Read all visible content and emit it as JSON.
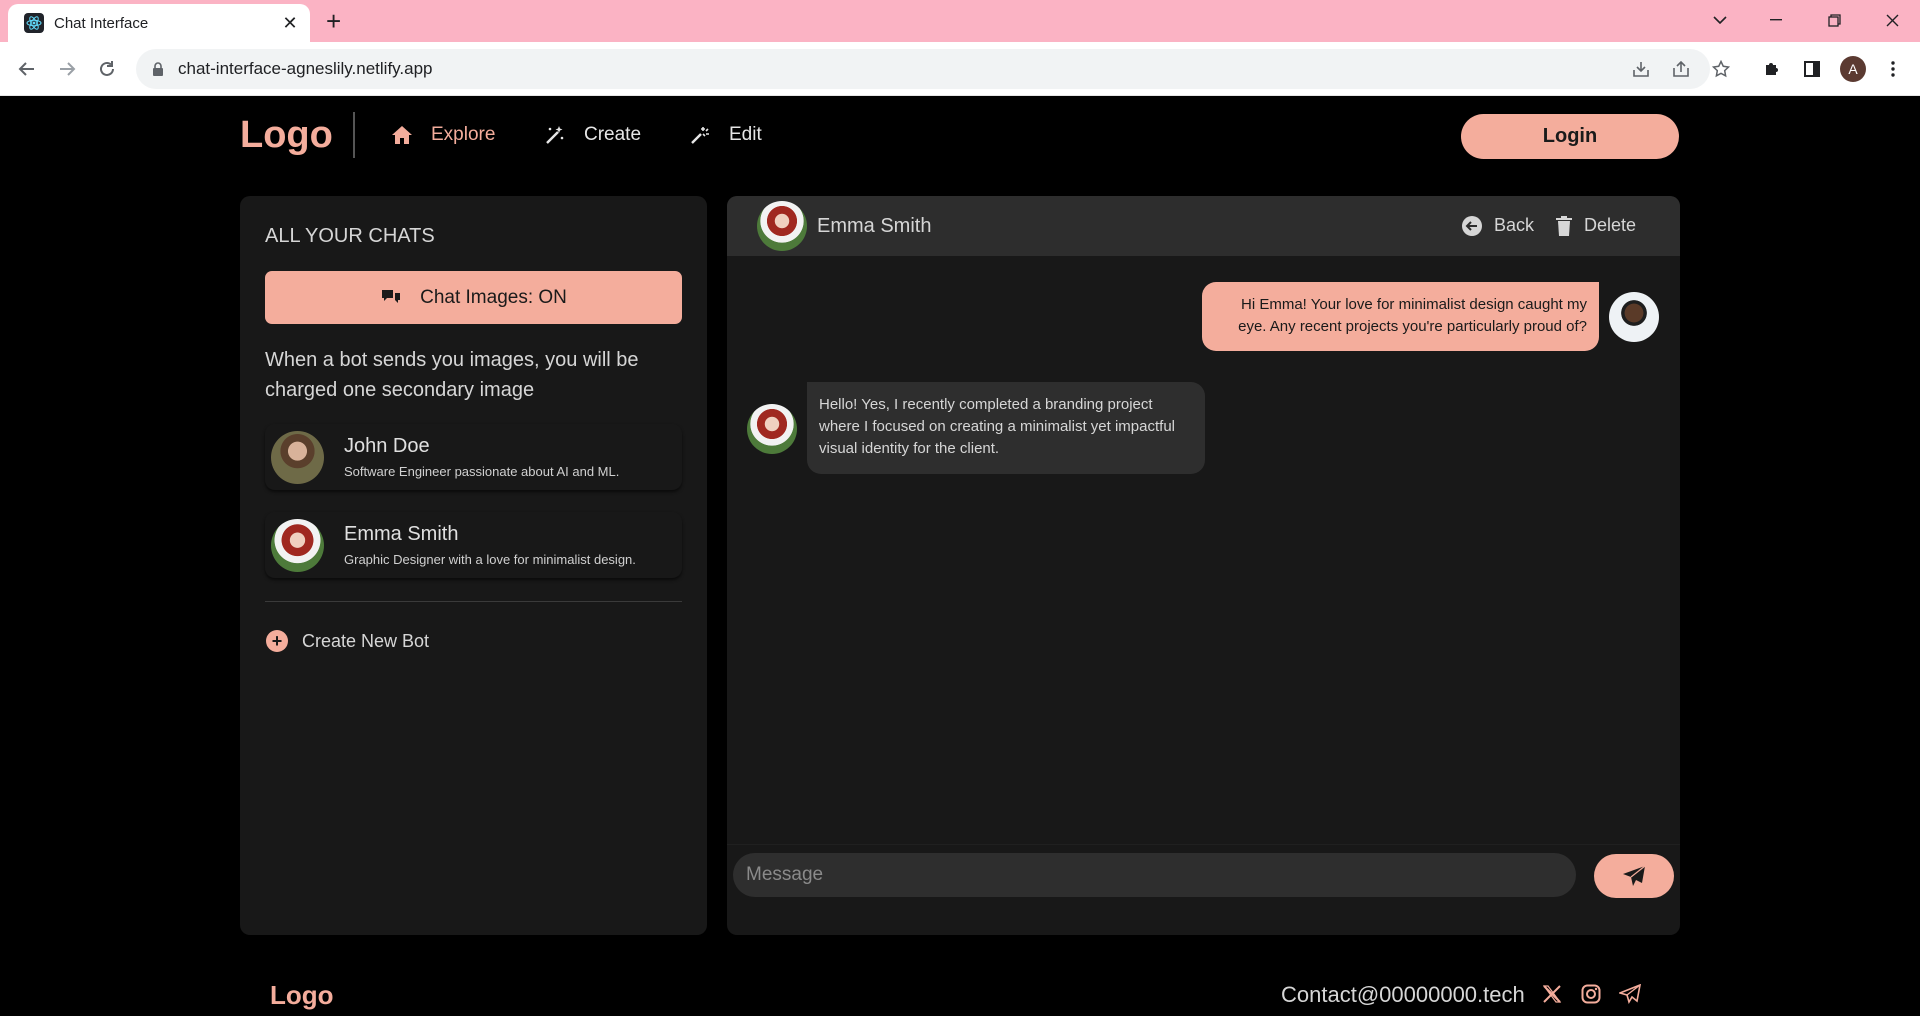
{
  "browser": {
    "tab_title": "Chat Interface",
    "url": "chat-interface-agneslily.netlify.app",
    "profile_initial": "A",
    "tabbar_color": "#fbb3c4"
  },
  "header": {
    "logo": "Logo",
    "nav": [
      {
        "label": "Explore",
        "icon": "home-icon",
        "active": true
      },
      {
        "label": "Create",
        "icon": "magic-wand-icon",
        "active": false
      },
      {
        "label": "Edit",
        "icon": "wand-sparkle-icon",
        "active": false
      }
    ],
    "login_label": "Login"
  },
  "sidebar": {
    "title": "ALL YOUR CHATS",
    "chat_images_label": "Chat Images: ON",
    "description": "When a bot sends you images, you will be charged one secondary image",
    "chats": [
      {
        "name": "John Doe",
        "subtitle": "Software Engineer passionate about AI and ML."
      },
      {
        "name": "Emma Smith",
        "subtitle": "Graphic Designer with a love for minimalist design."
      }
    ],
    "create_bot_label": "Create New Bot"
  },
  "chat": {
    "contact_name": "Emma Smith",
    "back_label": "Back",
    "delete_label": "Delete",
    "messages": [
      {
        "from": "user",
        "text": "Hi Emma! Your love for minimalist design caught my eye. Any recent projects you're particularly proud of?"
      },
      {
        "from": "bot",
        "text": "Hello! Yes, I recently completed a branding project where I focused on creating a minimalist yet impactful visual identity for the client."
      }
    ],
    "input_placeholder": "Message"
  },
  "footer": {
    "logo": "Logo",
    "contact": "Contact@00000000.tech",
    "social_icons": [
      "x-icon",
      "instagram-icon",
      "telegram-icon"
    ]
  },
  "colors": {
    "accent": "#f4ad9c",
    "background": "#000000",
    "panel": "#181818",
    "panel_header": "#2d2d2d"
  }
}
